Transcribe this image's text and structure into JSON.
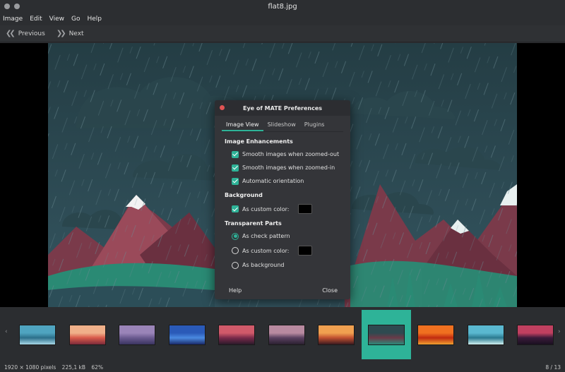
{
  "window": {
    "title": "flat8.jpg"
  },
  "menu": [
    "Image",
    "Edit",
    "View",
    "Go",
    "Help"
  ],
  "toolbar": {
    "previous_label": "Previous",
    "next_label": "Next"
  },
  "dialog": {
    "title": "Eye of MATE Preferences",
    "tabs": [
      "Image View",
      "Slideshow",
      "Plugins"
    ],
    "active_tab": "Image View",
    "enhancements": {
      "heading": "Image Enhancements",
      "options": [
        {
          "label": "Smooth images when zoomed-out",
          "checked": true
        },
        {
          "label": "Smooth images when zoomed-in",
          "checked": true
        },
        {
          "label": "Automatic orientation",
          "checked": true
        }
      ]
    },
    "background": {
      "heading": "Background",
      "custom_color_label": "As custom color:",
      "custom_color_checked": true,
      "color": "#000000"
    },
    "transparent": {
      "heading": "Transparent Parts",
      "options": [
        {
          "label": "As check pattern",
          "selected": true
        },
        {
          "label": "As custom color:",
          "selected": false
        },
        {
          "label": "As background",
          "selected": false
        }
      ],
      "color": "#000000"
    },
    "help_label": "Help",
    "close_label": "Close"
  },
  "filmstrip": {
    "thumbnails": [
      {
        "name": "thumb-lake",
        "colors": [
          "#4fa4c0",
          "#2c6f8a",
          "#a8d8e8"
        ]
      },
      {
        "name": "thumb-sunset-red",
        "colors": [
          "#f0b08a",
          "#d85a4a",
          "#7a2a3a"
        ]
      },
      {
        "name": "thumb-purple-hills",
        "colors": [
          "#9a84b8",
          "#6a5a90",
          "#3a3460"
        ]
      },
      {
        "name": "thumb-blue-sea",
        "colors": [
          "#2a5ab8",
          "#4a8ae0",
          "#1a2a6a"
        ]
      },
      {
        "name": "thumb-crimson",
        "colors": [
          "#d05a6a",
          "#7a2a4a",
          "#2a1a2a"
        ]
      },
      {
        "name": "thumb-forest-dusk",
        "colors": [
          "#b88aa0",
          "#5a4060",
          "#2a2030"
        ]
      },
      {
        "name": "thumb-orange-forest",
        "colors": [
          "#f0a050",
          "#c05030",
          "#3a1a20"
        ]
      },
      {
        "name": "thumb-rainy-mountains",
        "colors": [
          "#2e4a50",
          "#6a3a48",
          "#2b8a7a"
        ],
        "selected": true
      },
      {
        "name": "thumb-orange-dunes",
        "colors": [
          "#f07020",
          "#c02a10",
          "#f0a030"
        ]
      },
      {
        "name": "thumb-teal-trees",
        "colors": [
          "#5ab8d0",
          "#2a7a90",
          "#d0f0f0"
        ]
      },
      {
        "name": "thumb-night-pink",
        "colors": [
          "#c04060",
          "#3a1a3a",
          "#1a1020"
        ]
      }
    ]
  },
  "status": {
    "dimensions": "1920 × 1080 pixels",
    "size": "225,1 kB",
    "zoom": "62%",
    "position": "8 / 13"
  }
}
